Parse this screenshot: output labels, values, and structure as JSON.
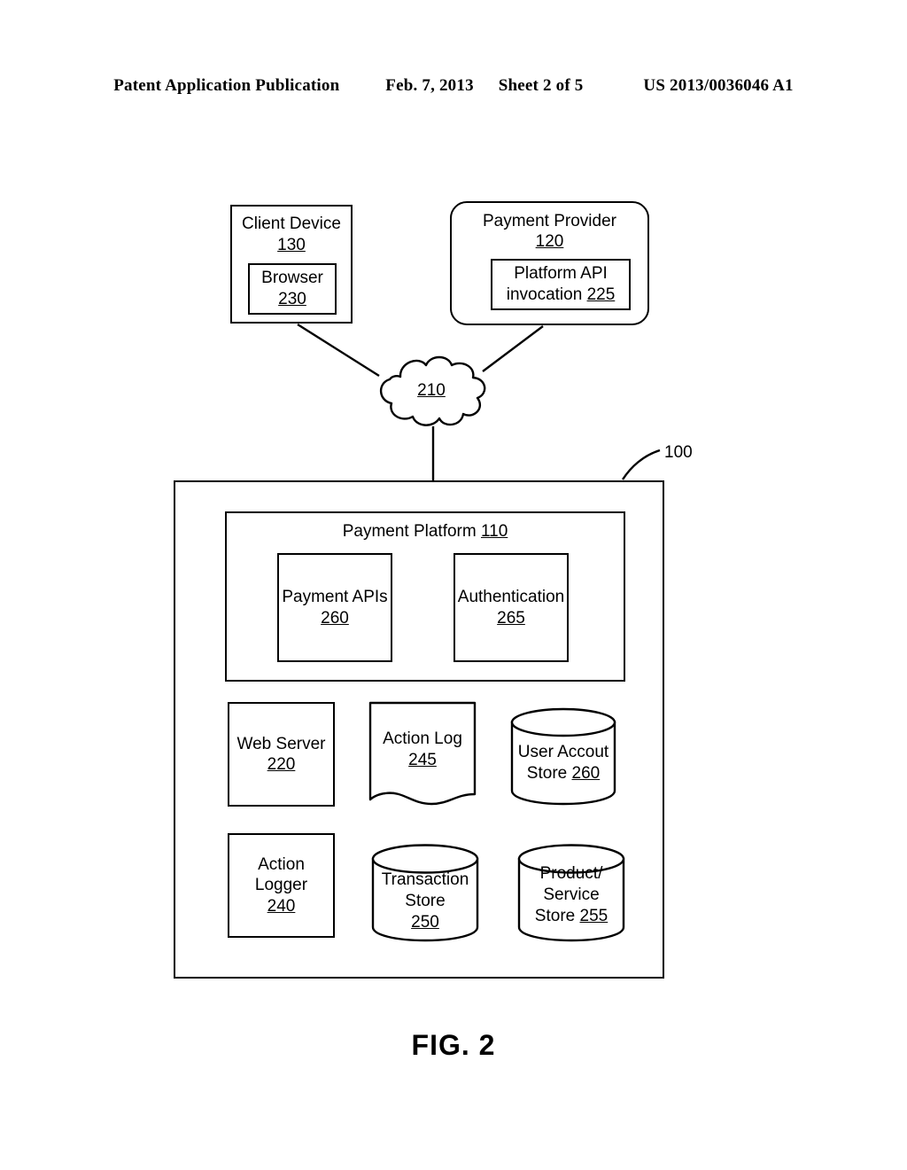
{
  "header": {
    "publication": "Patent Application Publication",
    "date": "Feb. 7, 2013",
    "sheet": "Sheet 2 of 5",
    "pub_number": "US 2013/0036046 A1"
  },
  "figure": {
    "caption": "FIG. 2",
    "system_ref": "100"
  },
  "diagram": {
    "client_device": {
      "title": "Client Device",
      "ref": "130",
      "browser": {
        "title": "Browser",
        "ref": "230"
      }
    },
    "payment_provider": {
      "title": "Payment Provider",
      "ref": "120",
      "platform_api": {
        "line1": "Platform API",
        "line2": "invocation",
        "ref": "225"
      }
    },
    "network_cloud": {
      "ref": "210"
    },
    "payment_platform": {
      "title": "Payment Platform",
      "ref": "110",
      "payment_apis": {
        "title": "Payment APIs",
        "ref": "260"
      },
      "authentication": {
        "title": "Authentication",
        "ref": "265"
      }
    },
    "web_server": {
      "title": "Web Server",
      "ref": "220"
    },
    "action_log": {
      "title": "Action Log",
      "ref": "245"
    },
    "user_account_store": {
      "line1": "User Accout",
      "line2": "Store",
      "ref": "260"
    },
    "action_logger": {
      "line1": "Action",
      "line2": "Logger",
      "ref": "240"
    },
    "transaction_store": {
      "line1": "Transaction",
      "line2": "Store",
      "ref": "250"
    },
    "product_service_store": {
      "line1": "Product/",
      "line2": "Service",
      "line3": "Store",
      "ref": "255"
    }
  },
  "colors": {
    "ink": "#000000",
    "paper": "#ffffff"
  }
}
